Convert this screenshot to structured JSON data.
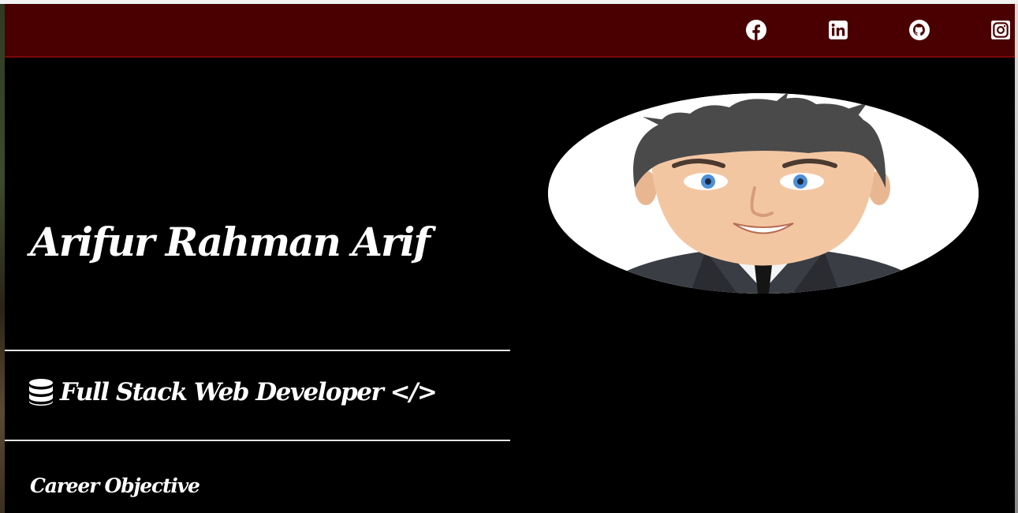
{
  "navbar": {
    "social_links": [
      {
        "icon": "facebook-icon"
      },
      {
        "icon": "linkedin-icon"
      },
      {
        "icon": "github-icon"
      },
      {
        "icon": "instagram-icon"
      }
    ]
  },
  "hero": {
    "name": "Arifur Rahman Arif",
    "role_icon": "database-icon",
    "role": "Full Stack Web Developer </>",
    "section_heading": "Career Objective",
    "avatar": "cartoon-man-in-suit"
  },
  "colors": {
    "navbar": "#4a0000",
    "navbar_border": "#7a0808",
    "background": "#000000",
    "text": "#ffffff",
    "divider": "#e6e6e6"
  }
}
